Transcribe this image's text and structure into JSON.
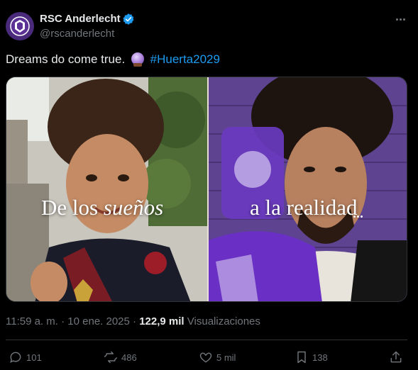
{
  "account": {
    "name": "RSC Anderlecht",
    "handle": "@rscanderlecht"
  },
  "tweet": {
    "text": "Dreams do come true.",
    "hashtag": "#Huerta2029"
  },
  "media": {
    "left_caption_plain": "De los ",
    "left_caption_italic": "sueños",
    "right_caption": "a la realidad"
  },
  "meta": {
    "time": "11:59 a. m.",
    "separator": "·",
    "date": "10 ene. 2025",
    "views_count": "122,9 mil",
    "views_label": "Visualizaciones"
  },
  "actions": {
    "replies": "101",
    "reposts": "486",
    "likes": "5 mil",
    "bookmarks": "138"
  },
  "colors": {
    "background": "#000000",
    "accent": "#1d9bf0",
    "muted": "#71767b",
    "club_purple": "#4a2a7a"
  }
}
